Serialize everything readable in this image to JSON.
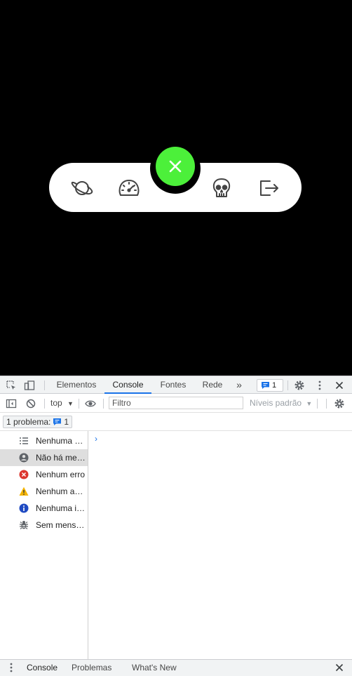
{
  "app": {
    "fab_icon": "close-icon",
    "fab_color": "#4cf03a",
    "nav_icons": [
      "planet-icon",
      "speedometer-icon",
      "skull-icon",
      "logout-icon"
    ]
  },
  "devtools": {
    "tabs": [
      "Elementos",
      "Console",
      "Fontes",
      "Rede"
    ],
    "active_tab": "Console",
    "more_tabs": "»",
    "issue_count": "1",
    "context": "top",
    "filter_placeholder": "Filtro",
    "levels": "Níveis padrão",
    "problems_label": "1 problema:",
    "problems_count": "1",
    "sidebar": [
      {
        "label": "Nenhuma mensagem",
        "icon": "list-icon"
      },
      {
        "label": "Não há mensagens do usuário",
        "icon": "user-icon",
        "selected": true
      },
      {
        "label": "Nenhum erro",
        "icon": "error-icon"
      },
      {
        "label": "Nenhum aviso",
        "icon": "warning-icon"
      },
      {
        "label": "Nenhuma informação",
        "icon": "info-icon"
      },
      {
        "label": "Sem mensagens detalhadas",
        "icon": "bug-icon"
      }
    ],
    "prompt": "›",
    "drawer_tabs": [
      "Console",
      "Problemas",
      "What's New"
    ]
  }
}
